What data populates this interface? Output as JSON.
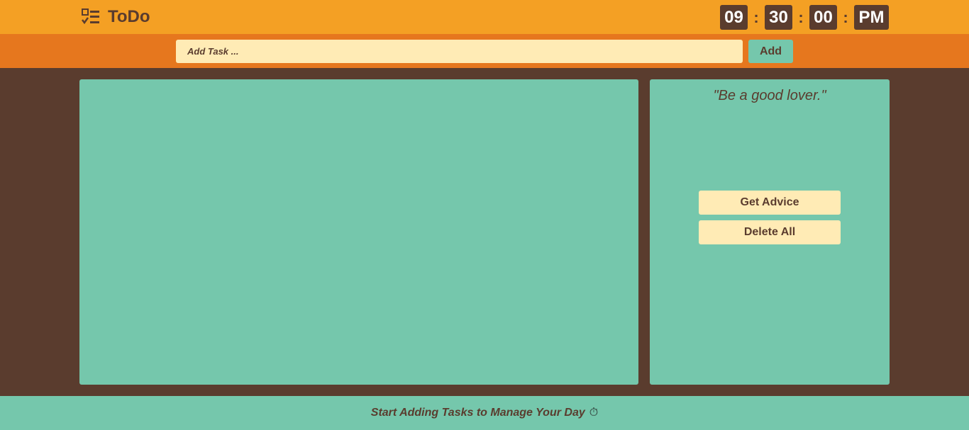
{
  "header": {
    "app_title": "ToDo",
    "logo_icon": "checklist-icon",
    "clock": {
      "hours": "09",
      "minutes": "30",
      "seconds": "00",
      "ampm": "PM",
      "separator": ":"
    }
  },
  "addbar": {
    "input_placeholder": "Add Task ...",
    "input_value": "",
    "add_label": "Add"
  },
  "tasks": [],
  "sidebar": {
    "quote": "\"Be a good lover.\"",
    "advice_label": "Get Advice",
    "delete_label": "Delete All"
  },
  "footer": {
    "message": "Start Adding Tasks to Manage Your Day",
    "icon": "stopwatch-icon",
    "icon_glyph": "⏱"
  },
  "colors": {
    "header": "#f4a024",
    "addbar": "#e6771e",
    "background": "#5a3c2e",
    "panel": "#75c7ac",
    "input": "#ffebb5",
    "text": "#5a3c2e"
  }
}
